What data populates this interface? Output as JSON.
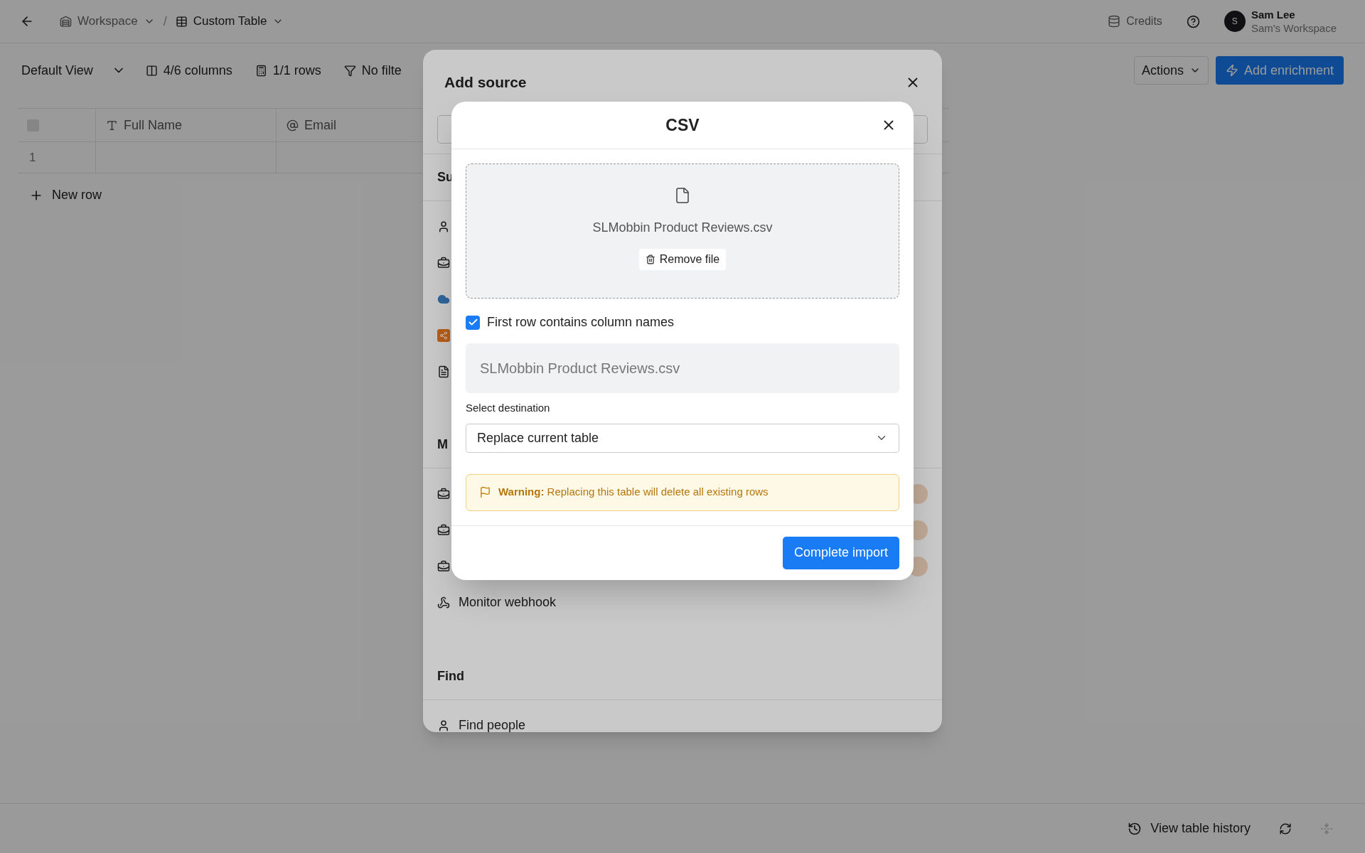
{
  "topbar": {
    "breadcrumbs": [
      {
        "label": "Workspace",
        "kind": "workspace",
        "current": false
      },
      {
        "label": "Custom Table",
        "kind": "table",
        "current": true
      }
    ],
    "separator": "/",
    "credits": "Credits",
    "user": {
      "initial": "S",
      "name": "Sam Lee",
      "workspace": "Sam's Workspace"
    }
  },
  "toolbar": {
    "view": "Default View",
    "columns": "4/6 columns",
    "rows": "1/1 rows",
    "filter": "No filte",
    "actions": "Actions",
    "add_enrichment": "Add enrichment"
  },
  "table": {
    "select_all": {
      "checked": false
    },
    "columns": [
      {
        "label": "Full Name",
        "kind": "text"
      },
      {
        "label": "Email",
        "kind": "email"
      }
    ],
    "rows": [
      {
        "number": "1"
      }
    ],
    "new_row": "New row"
  },
  "add_source": {
    "title": "Add source",
    "sections": [
      {
        "heading": "Su",
        "items": [
          {
            "kind": "person"
          },
          {
            "kind": "briefcase"
          },
          {
            "kind": "cloud"
          },
          {
            "kind": "hub"
          },
          {
            "kind": "document"
          }
        ]
      },
      {
        "heading": "M",
        "items": [
          {
            "kind": "briefcase",
            "badge": true
          },
          {
            "kind": "briefcase",
            "badge": true
          },
          {
            "kind": "briefcase",
            "badge": true
          },
          {
            "kind": "webhook",
            "label": "Monitor webhook"
          }
        ]
      },
      {
        "heading": "Find",
        "items": [
          {
            "kind": "person",
            "label": "Find people"
          }
        ]
      }
    ]
  },
  "csv_dialog": {
    "title": "CSV",
    "file_name": "SLMobbin Product Reviews.csv",
    "remove_label": "Remove file",
    "header_row": {
      "label": "First row contains column names",
      "checked": true
    },
    "table_name": "SLMobbin Product Reviews.csv",
    "destination_label": "Select destination",
    "destination": "Replace current table",
    "warning": "**Warning:** Replacing this table will delete all existing rows",
    "submit": "Complete import"
  },
  "footer": {
    "history": "View table history"
  }
}
